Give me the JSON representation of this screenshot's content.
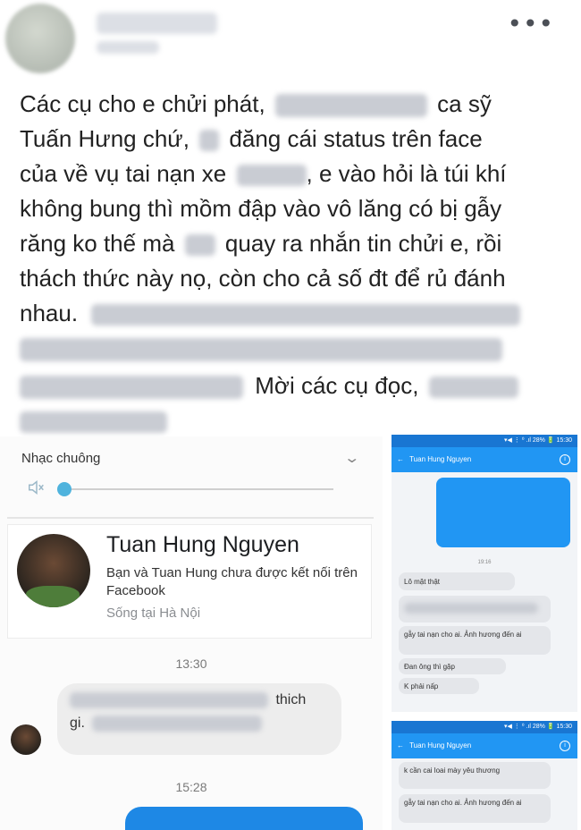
{
  "post": {
    "more_icon": "more-horizontal-icon",
    "lines": [
      [
        "Các cụ cho e chửi phát,",
        "ca sỹ"
      ],
      [
        "Tuấn Hưng chứ,",
        "đăng cái status trên face"
      ],
      [
        "của về vụ tai nạn xe",
        ", e vào hỏi là túi khí"
      ],
      [
        "không bung thì mồm đập vào vô lăng có bị gẫy"
      ],
      [
        "răng ko thế mà",
        "quay ra nhắn tin chửi e, rồi"
      ],
      [
        "thách thức này nọ, còn cho cả số đt để rủ đánh"
      ],
      [
        "nhau."
      ],
      [
        "Mời các cụ đọc,"
      ]
    ]
  },
  "left_shot": {
    "ringtone_label": "Nhạc chuông",
    "profile": {
      "name": "Tuan Hung Nguyen",
      "connection": "Bạn và Tuan Hung chưa được kết nối trên Facebook",
      "location": "Sống tại Hà Nội"
    },
    "time_1": "13:30",
    "message": {
      "line1_end": "thich",
      "line2_start": "gi."
    },
    "time_2": "15:28"
  },
  "right_shot_1": {
    "status": "▾◀ ⋮ ⁰ .ıl 28% 🔋 15:30",
    "contact": "Tuan Hung Nguyen",
    "time": "19:16",
    "messages": [
      "Lô mặt thật",
      "gẫy tai nạn cho ai. Ảnh hương đến ai",
      "Đan ông thì gặp",
      "K phải nấp"
    ]
  },
  "right_shot_2": {
    "status": "▾◀ ⋮ ⁰ .ıl 28% 🔋 15:30",
    "contact": "Tuan Hung Nguyen",
    "messages": [
      "k cần cai loai mày yêu thương",
      "gẫy tai nạn cho ai. Ảnh hương đến ai"
    ]
  }
}
